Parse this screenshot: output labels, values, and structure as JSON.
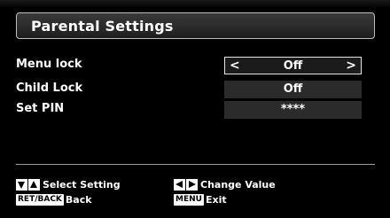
{
  "window": {
    "title": "Parental Settings"
  },
  "settings": [
    {
      "label": "Menu lock",
      "value": "Off",
      "selected": true
    },
    {
      "label": "Child Lock",
      "value": "Off",
      "selected": false
    },
    {
      "label": "Set PIN",
      "value": "****",
      "selected": false
    }
  ],
  "arrows": {
    "left": "<",
    "right": ">"
  },
  "hints": {
    "select_setting": "Select Setting",
    "back_key": "RET/BACK",
    "back": "Back",
    "change_value": "Change Value",
    "menu_key": "MENU",
    "exit": "Exit"
  },
  "colors": {
    "background": "#000000",
    "value_cell": "#2b2b2b",
    "border": "#e6e6e6"
  },
  "icons": [
    "down-arrow-icon",
    "up-arrow-icon",
    "left-arrow-icon",
    "right-arrow-icon"
  ]
}
